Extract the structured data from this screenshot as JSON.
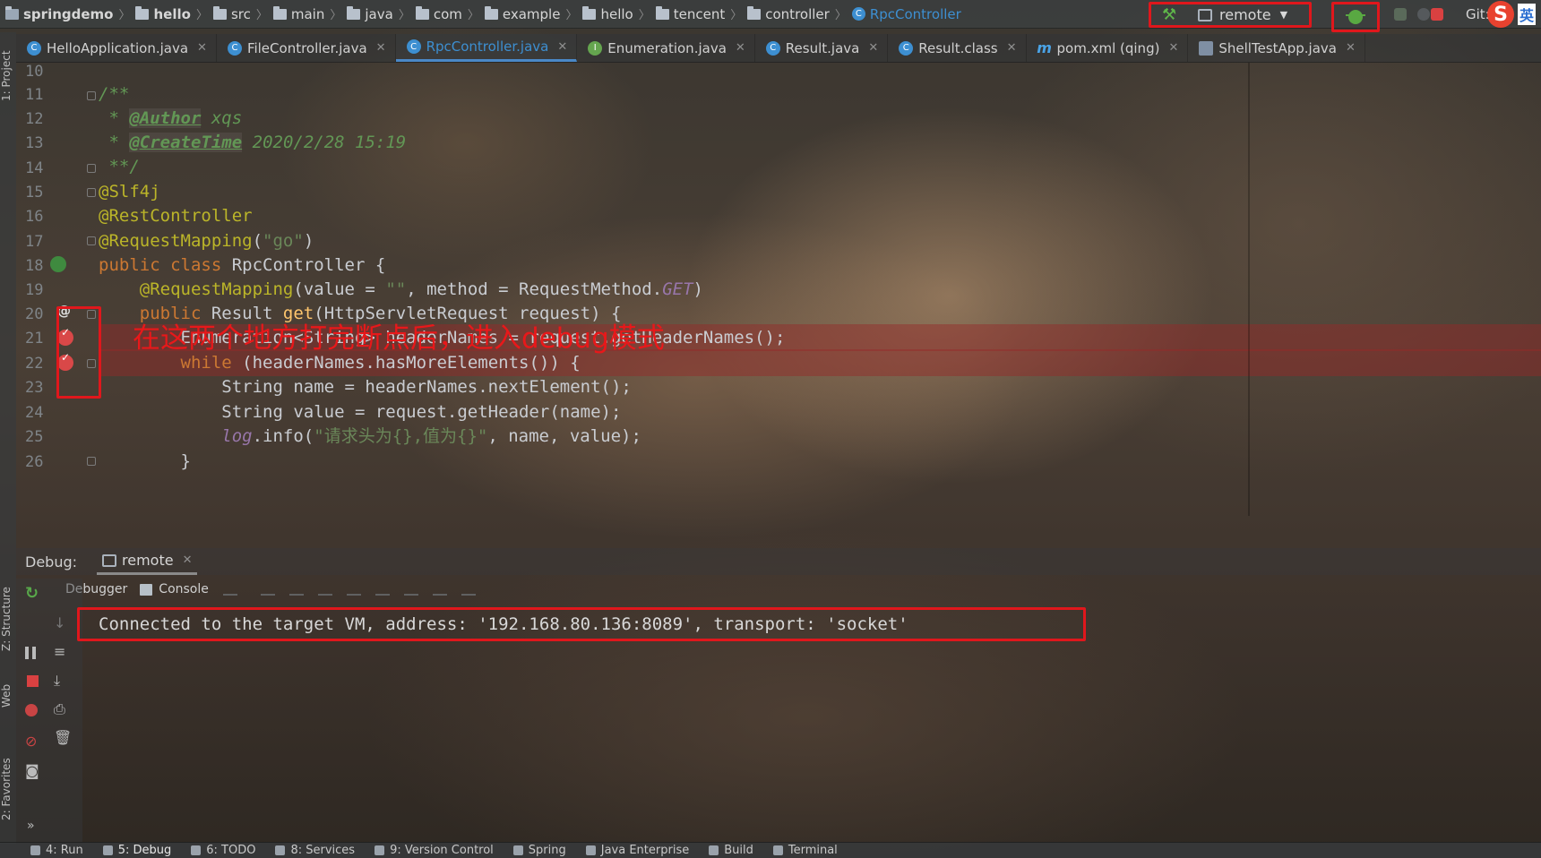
{
  "breadcrumbs": [
    {
      "label": "springdemo",
      "icon": "project-icon",
      "bold": true
    },
    {
      "label": "hello",
      "icon": "folder-icon",
      "bold": true
    },
    {
      "label": "src",
      "icon": "folder-icon"
    },
    {
      "label": "main",
      "icon": "folder-icon"
    },
    {
      "label": "java",
      "icon": "folder-icon"
    },
    {
      "label": "com",
      "icon": "folder-icon"
    },
    {
      "label": "example",
      "icon": "folder-icon"
    },
    {
      "label": "hello",
      "icon": "folder-icon"
    },
    {
      "label": "tencent",
      "icon": "folder-icon"
    },
    {
      "label": "controller",
      "icon": "folder-icon"
    },
    {
      "label": "RpcController",
      "icon": "class-icon"
    }
  ],
  "toolbar": {
    "run_config": "remote",
    "git_label": "Git:",
    "ime_label": "英"
  },
  "tabs": [
    {
      "label": "HelloApplication.java",
      "icon": "class-icon"
    },
    {
      "label": "FileController.java",
      "icon": "class-icon"
    },
    {
      "label": "RpcController.java",
      "icon": "class-icon",
      "active": true
    },
    {
      "label": "Enumeration.java",
      "icon": "interface-icon"
    },
    {
      "label": "Result.java",
      "icon": "class-icon"
    },
    {
      "label": "Result.class",
      "icon": "compiled-class-icon"
    },
    {
      "label": "pom.xml (qing)",
      "icon": "maven-icon"
    },
    {
      "label": "ShellTestApp.java",
      "icon": "shell-icon"
    }
  ],
  "left_strip": {
    "project": "1: Project",
    "structure": "Z: Structure",
    "web": "Web",
    "favorites": "2: Favorites"
  },
  "editor": {
    "line_numbers": [
      "10",
      "11",
      "12",
      "13",
      "14",
      "15",
      "16",
      "17",
      "18",
      "19",
      "20",
      "21",
      "22",
      "23",
      "24",
      "25",
      "26"
    ],
    "doc_author_tag": "@Author",
    "doc_author": "xqs",
    "doc_time_tag": "@CreateTime",
    "doc_time": "2020/2/28 15:19",
    "ann_slf4j": "@Slf4j",
    "ann_rest": "@RestController",
    "ann_request": "@RequestMapping",
    "go": "\"go\"",
    "class_name": "RpcController",
    "empty_str": "\"\"",
    "get_const": "GET",
    "log_str": "\"请求头为{},值为{}\""
  },
  "annotation_note": "在这两个地方打完断点后，进入debug模式",
  "debug": {
    "label": "Debug:",
    "session": "remote",
    "debugger_tab": "Debugger",
    "console_tab": "Console",
    "console_output": "Connected to the target VM, address: '192.168.80.136:8089', transport: 'socket'"
  },
  "statusbar": [
    {
      "label": "4: Run",
      "icon": "run-icon"
    },
    {
      "label": "5: Debug",
      "icon": "debug-icon",
      "active": true
    },
    {
      "label": "6: TODO",
      "icon": "todo-icon"
    },
    {
      "label": "8: Services",
      "icon": "services-icon"
    },
    {
      "label": "9: Version Control",
      "icon": "vcs-icon"
    },
    {
      "label": "Spring",
      "icon": "spring-icon"
    },
    {
      "label": "Java Enterprise",
      "icon": "java-enterprise-icon"
    },
    {
      "label": "Build",
      "icon": "build-icon"
    },
    {
      "label": "Terminal",
      "icon": "terminal-icon"
    }
  ],
  "colors": {
    "highlight_red": "#e0171c",
    "link_blue": "#3d8fd1",
    "annotation_yellow": "#bbb529",
    "keyword_orange": "#cc7832"
  }
}
